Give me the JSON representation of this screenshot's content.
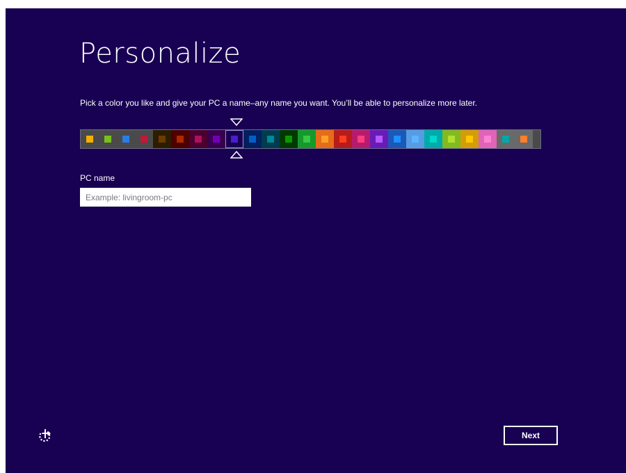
{
  "page": {
    "title": "Personalize",
    "subtitle": "Pick a color you like and give your PC a name–any name you want. You’ll be able to personalize more later."
  },
  "color_picker": {
    "selected_index": 8,
    "swatches": [
      {
        "bg": "#4a4a4a",
        "fg": "#f3b000"
      },
      {
        "bg": "#4a4a4a",
        "fg": "#7ac01c"
      },
      {
        "bg": "#4a4a4a",
        "fg": "#2a7de8"
      },
      {
        "bg": "#4a4a4a",
        "fg": "#c4163a"
      },
      {
        "bg": "#2d1c00",
        "fg": "#6b3c00"
      },
      {
        "bg": "#4d0000",
        "fg": "#b02800"
      },
      {
        "bg": "#4a0030",
        "fg": "#b0105a"
      },
      {
        "bg": "#3a0050",
        "fg": "#7000b8"
      },
      {
        "bg": "#180052",
        "fg": "#4a1eca"
      },
      {
        "bg": "#002060",
        "fg": "#0060c8"
      },
      {
        "bg": "#003c50",
        "fg": "#008894"
      },
      {
        "bg": "#003a00",
        "fg": "#0e9800"
      },
      {
        "bg": "#15992a",
        "fg": "#36c848"
      },
      {
        "bg": "#e56c19",
        "fg": "#ffa028"
      },
      {
        "bg": "#b81b1b",
        "fg": "#ff3c1e"
      },
      {
        "bg": "#b81b6c",
        "fg": "#ff3c7e"
      },
      {
        "bg": "#691bb8",
        "fg": "#b45aff"
      },
      {
        "bg": "#1b58b8",
        "fg": "#1e90ff"
      },
      {
        "bg": "#569ce3",
        "fg": "#5ab4ff"
      },
      {
        "bg": "#00aaaa",
        "fg": "#00d8cc"
      },
      {
        "bg": "#83ba1f",
        "fg": "#b0e030"
      },
      {
        "bg": "#d39d09",
        "fg": "#ffc800"
      },
      {
        "bg": "#e064b7",
        "fg": "#ff82d2"
      },
      {
        "bg": "#696969",
        "fg": "#00a8a8"
      },
      {
        "bg": "#696969",
        "fg": "#ff7f2a"
      }
    ]
  },
  "pc_name": {
    "label": "PC name",
    "placeholder": "Example: livingroom-pc",
    "value": ""
  },
  "footer": {
    "next_label": "Next"
  },
  "icons": {
    "ease_of_access": "ease-of-access-icon",
    "marker_top": "triangle-down-icon",
    "marker_bottom": "triangle-up-icon"
  },
  "colors": {
    "background": "#180052",
    "text": "#ffffff"
  }
}
